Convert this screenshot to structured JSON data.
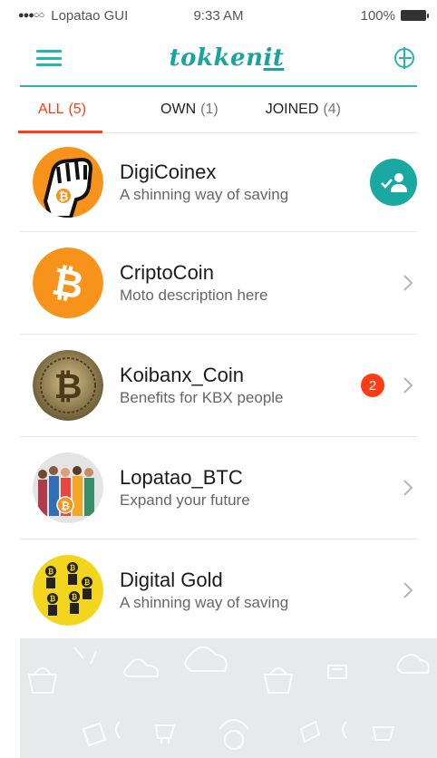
{
  "status_bar": {
    "carrier": "Lopatao GUI",
    "time": "9:33 AM",
    "battery": "100%"
  },
  "header": {
    "logo_main": "tokken",
    "logo_accent": "it"
  },
  "tabs": [
    {
      "label": "ALL",
      "count": "(5)",
      "active": true
    },
    {
      "label": "OWN",
      "count": "(1)",
      "active": false
    },
    {
      "label": "JOINED",
      "count": "(4)",
      "active": false
    }
  ],
  "items": [
    {
      "name": "DigiCoinex",
      "description": "A shinning way of saving",
      "action": "join"
    },
    {
      "name": "CriptoCoin",
      "description": "Moto description here",
      "action": "chevron"
    },
    {
      "name": "Koibanx_Coin",
      "description": "Benefits for KBX people",
      "action": "chevron",
      "badge": "2"
    },
    {
      "name": "Lopatao_BTC",
      "description": "Expand your future",
      "action": "chevron"
    },
    {
      "name": "Digital Gold",
      "description": "A shinning way of saving",
      "action": "chevron"
    }
  ],
  "colors": {
    "accent": "#1aa8a3",
    "active_tab": "#ff3d14",
    "bitcoin_orange": "#f7931a",
    "gold": "#f2d51c"
  }
}
